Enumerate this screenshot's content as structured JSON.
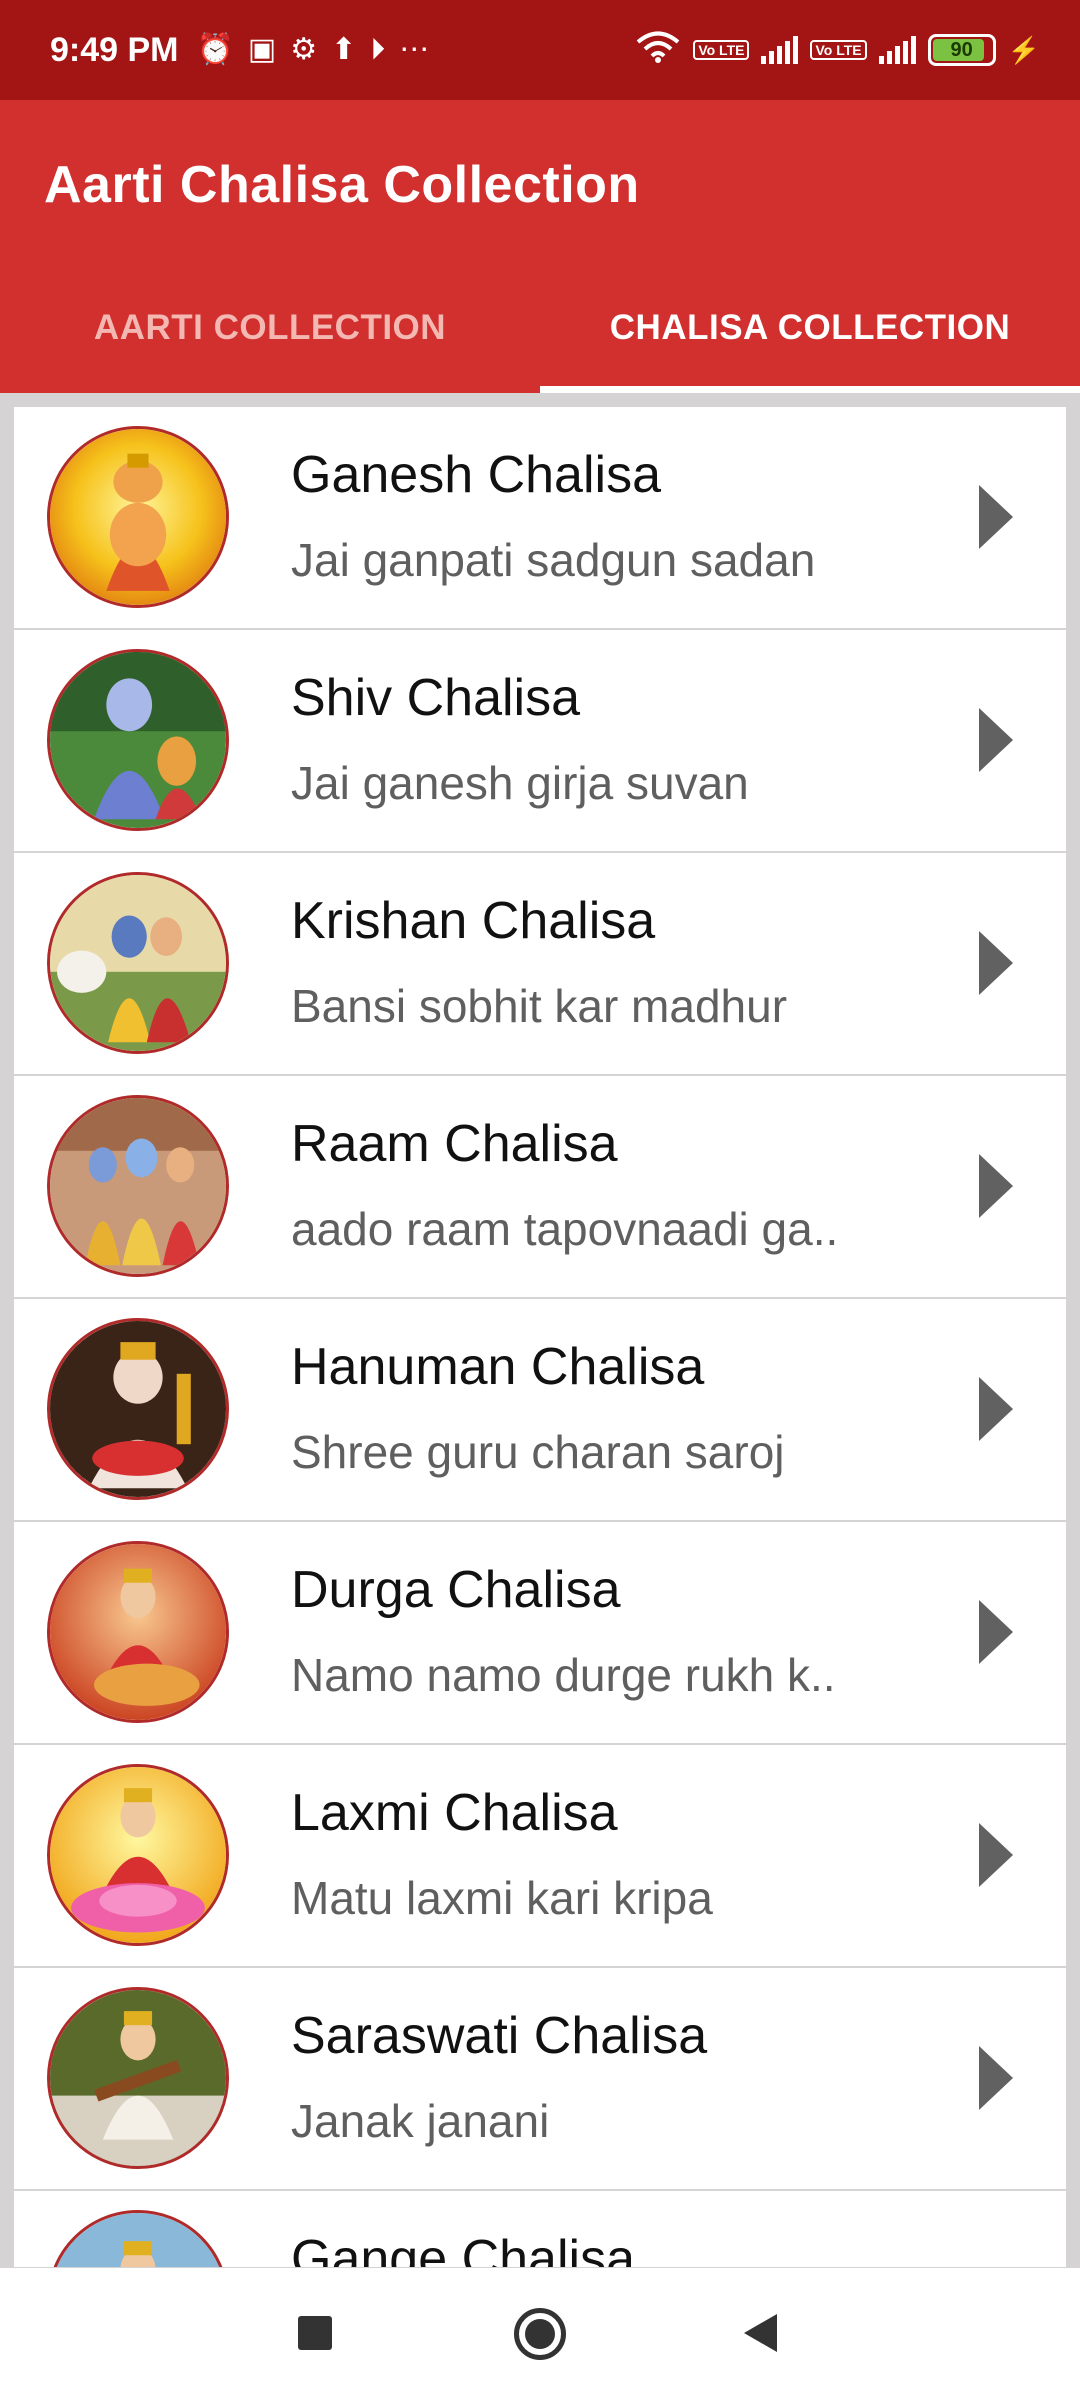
{
  "status_bar": {
    "time": "9:49 PM",
    "left_icons": [
      "alarm-icon",
      "message-icon",
      "settings-icon",
      "upload-icon",
      "play-icon",
      "more-icon"
    ],
    "right_icons": [
      "wifi-icon",
      "volte-icon",
      "signal-icon",
      "volte-icon",
      "signal-icon",
      "battery-icon",
      "charging-icon"
    ],
    "volte_label": "Vo LTE",
    "battery_level": "90"
  },
  "app_bar": {
    "title": "Aarti Chalisa Collection",
    "background_color": "#d22f2f"
  },
  "tabs": [
    {
      "label": "AARTI COLLECTION",
      "active": false
    },
    {
      "label": "CHALISA COLLECTION",
      "active": true
    }
  ],
  "list": [
    {
      "title": "Ganesh Chalisa",
      "subtitle": "Jai ganpati sadgun sadan",
      "image": "ganesh-image"
    },
    {
      "title": "Shiv Chalisa",
      "subtitle": "Jai ganesh girja suvan",
      "image": "shiv-image"
    },
    {
      "title": "Krishan Chalisa",
      "subtitle": "Bansi sobhit kar madhur",
      "image": "krishan-image"
    },
    {
      "title": "Raam Chalisa",
      "subtitle": "aado raam tapovnaadi ga..",
      "image": "raam-image"
    },
    {
      "title": "Hanuman Chalisa",
      "subtitle": "Shree guru charan saroj",
      "image": "hanuman-image"
    },
    {
      "title": "Durga Chalisa",
      "subtitle": "Namo namo durge rukh k..",
      "image": "durga-image"
    },
    {
      "title": "Laxmi Chalisa",
      "subtitle": "Matu laxmi kari kripa",
      "image": "laxmi-image"
    },
    {
      "title": "Saraswati Chalisa",
      "subtitle": "Janak janani",
      "image": "saraswati-image"
    },
    {
      "title": "Gange Chalisa",
      "subtitle": "",
      "image": "gange-image"
    }
  ],
  "nav_bar": {
    "buttons": [
      "recents-button",
      "home-button",
      "back-button"
    ]
  }
}
